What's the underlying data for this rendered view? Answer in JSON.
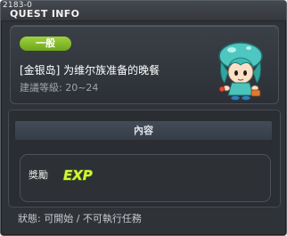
{
  "window": {
    "id_label": "2183-0",
    "title": "QUEST INFO"
  },
  "quest": {
    "category": "一般",
    "name": "[金银岛] 为维尔族准备的晚餐",
    "recommended_level": "建議等級: 20~24",
    "npc_icon": "mushroom-girl-npc"
  },
  "content": {
    "section_title": "內容",
    "reward_label": "獎勵",
    "reward_icon": "exp-icon",
    "reward_icon_text": "EXP"
  },
  "status": {
    "text": "狀態: 可開始 / 不可執行任務"
  },
  "colors": {
    "badge_green": "#7fb726",
    "panel_bg": "#2f3237",
    "exp_yellow": "#d8f23a"
  }
}
